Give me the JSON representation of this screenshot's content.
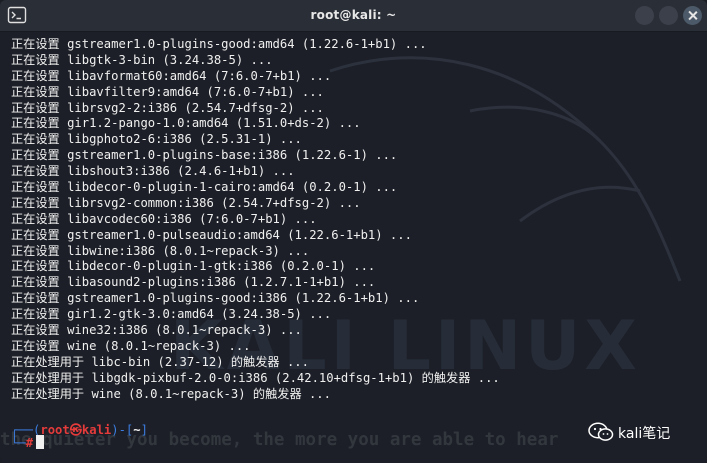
{
  "window": {
    "title": "root@kali: ~"
  },
  "output_lines": [
    "正在设置 gstreamer1.0-plugins-good:amd64 (1.22.6-1+b1) ...",
    "正在设置 libgtk-3-bin (3.24.38-5) ...",
    "正在设置 libavformat60:amd64 (7:6.0-7+b1) ...",
    "正在设置 libavfilter9:amd64 (7:6.0-7+b1) ...",
    "正在设置 librsvg2-2:i386 (2.54.7+dfsg-2) ...",
    "正在设置 gir1.2-pango-1.0:amd64 (1.51.0+ds-2) ...",
    "正在设置 libgphoto2-6:i386 (2.5.31-1) ...",
    "正在设置 gstreamer1.0-plugins-base:i386 (1.22.6-1) ...",
    "正在设置 libshout3:i386 (2.4.6-1+b1) ...",
    "正在设置 libdecor-0-plugin-1-cairo:amd64 (0.2.0-1) ...",
    "正在设置 librsvg2-common:i386 (2.54.7+dfsg-2) ...",
    "正在设置 libavcodec60:i386 (7:6.0-7+b1) ...",
    "正在设置 gstreamer1.0-pulseaudio:amd64 (1.22.6-1+b1) ...",
    "正在设置 libwine:i386 (8.0.1~repack-3) ...",
    "正在设置 libdecor-0-plugin-1-gtk:i386 (0.2.0-1) ...",
    "正在设置 libasound2-plugins:i386 (1.2.7.1-1+b1) ...",
    "正在设置 gstreamer1.0-plugins-good:i386 (1.22.6-1+b1) ...",
    "正在设置 gir1.2-gtk-3.0:amd64 (3.24.38-5) ...",
    "正在设置 wine32:i386 (8.0.1~repack-3) ...",
    "正在设置 wine (8.0.1~repack-3) ...",
    "正在处理用于 libc-bin (2.37-12) 的触发器 ...",
    "正在处理用于 libgdk-pixbuf-2.0-0:i386 (2.42.10+dfsg-1+b1) 的触发器 ...",
    "正在处理用于 wine (8.0.1~repack-3) 的触发器 ..."
  ],
  "prompt": {
    "line1_open": "┌──(",
    "user": "root㉿kali",
    "line1_mid": ")-[",
    "path": "~",
    "line1_close": "]",
    "line2_corner": "└─",
    "symbol": "#"
  },
  "background": {
    "logo_word": "KALI LINUX",
    "slogan": "the quieter you become, the more you are able to hear"
  },
  "watermark": {
    "text": "kali笔记"
  },
  "colors": {
    "prompt_blue": "#3b7de0",
    "prompt_red": "#e53b3b",
    "text": "#f0f0f0"
  }
}
